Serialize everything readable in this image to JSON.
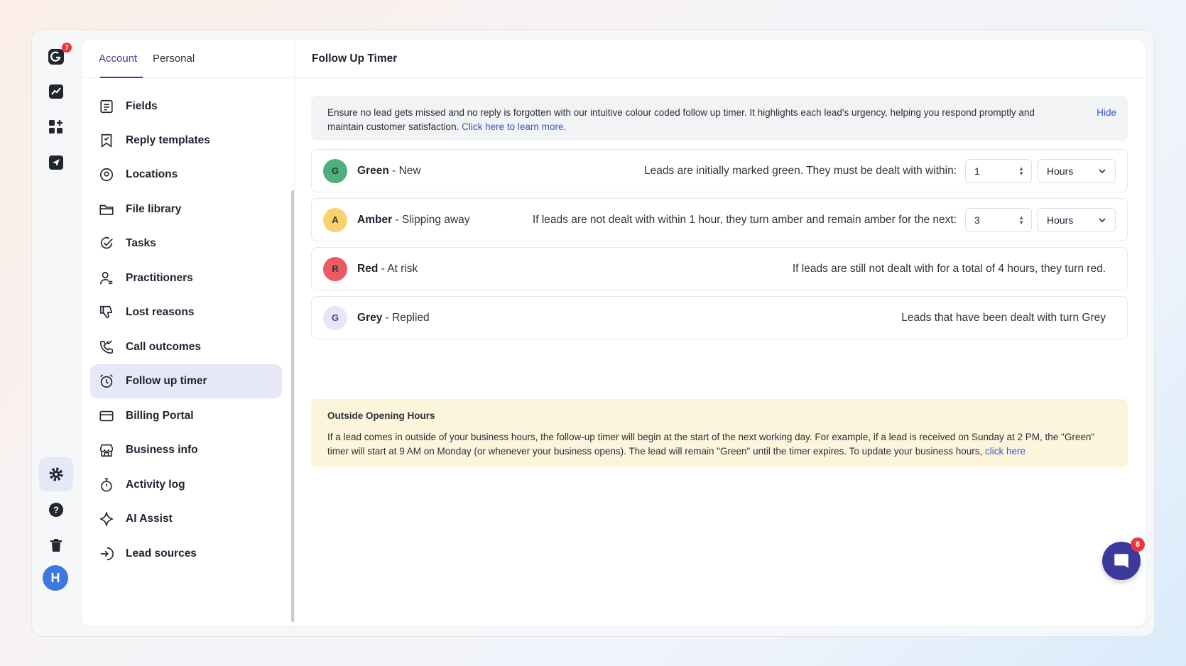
{
  "rail": {
    "logo_badge": "7",
    "avatar_initial": "H"
  },
  "sidebar": {
    "tabs": [
      {
        "label": "Account"
      },
      {
        "label": "Personal"
      }
    ],
    "items": [
      {
        "label": "Fields",
        "icon": "list-icon"
      },
      {
        "label": "Reply templates",
        "icon": "bookmark-icon"
      },
      {
        "label": "Locations",
        "icon": "map-pin-icon"
      },
      {
        "label": "File library",
        "icon": "folder-icon"
      },
      {
        "label": "Tasks",
        "icon": "check-circle-icon"
      },
      {
        "label": "Practitioners",
        "icon": "user-icon"
      },
      {
        "label": "Lost reasons",
        "icon": "thumbs-down-icon"
      },
      {
        "label": "Call outcomes",
        "icon": "phone-icon"
      },
      {
        "label": "Follow up timer",
        "icon": "alarm-clock-icon",
        "active": true
      },
      {
        "label": "Billing Portal",
        "icon": "credit-card-icon"
      },
      {
        "label": "Business info",
        "icon": "store-icon"
      },
      {
        "label": "Activity log",
        "icon": "stopwatch-icon"
      },
      {
        "label": "AI Assist",
        "icon": "sparkle-icon"
      },
      {
        "label": "Lead sources",
        "icon": "login-arrow-icon"
      }
    ]
  },
  "main": {
    "title": "Follow Up Timer",
    "info": {
      "text": "Ensure no lead gets missed and no reply is forgotten with our intuitive colour coded follow up timer. It highlights each lead's urgency, helping you respond promptly and maintain customer satisfaction. ",
      "link": "Click here to learn more.",
      "hide": "Hide"
    },
    "rows": [
      {
        "letter": "G",
        "name": "Green",
        "status": " - New",
        "desc": "Leads are initially marked green. They must be dealt with within:",
        "value": "1",
        "unit": "Hours",
        "color": "#4caf7d"
      },
      {
        "letter": "A",
        "name": "Amber",
        "status": " - Slipping away",
        "desc": "If leads are not dealt with within 1 hour, they turn amber and remain amber for the next:",
        "value": "3",
        "unit": "Hours",
        "color": "#fbd16b"
      },
      {
        "letter": "R",
        "name": "Red",
        "status": " - At risk",
        "desc": "If leads are still not dealt with for a total of 4 hours, they turn red.",
        "color": "#ee5a63"
      },
      {
        "letter": "G",
        "name": "Grey",
        "status": " - Replied",
        "desc": "Leads that have been dealt with turn Grey",
        "color": "#e7e6fa"
      }
    ],
    "outside_hours": {
      "title": "Outside Opening Hours",
      "text": "If a lead comes in outside of your business hours, the follow-up timer will begin at the start of the next working day. For example, if a lead is received on Sunday at 2 PM, the \"Green\" timer will start at 9 AM on Monday (or whenever your business opens). The lead will remain \"Green\" until the timer expires. To update your business hours, ",
      "link": "click here"
    }
  },
  "chat": {
    "badge": "8"
  }
}
